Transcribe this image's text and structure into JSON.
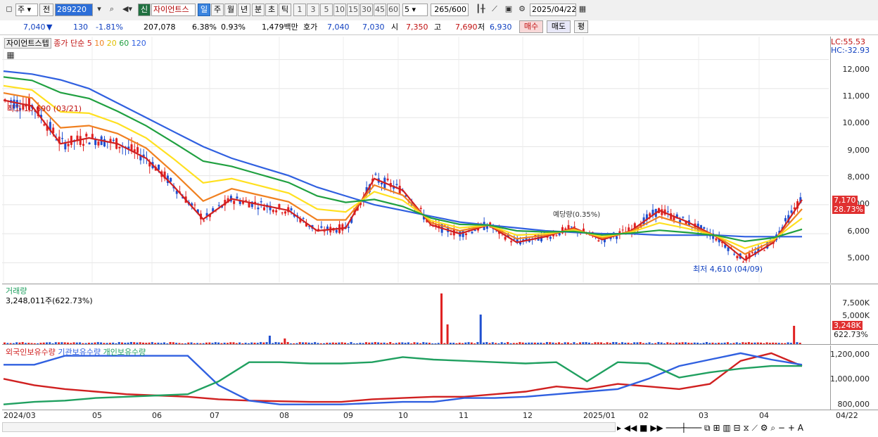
{
  "toolbar": {
    "type_select": "주",
    "prev_label": "전",
    "code_value": "289220",
    "new_badge": "신",
    "stock_name": "자이언트스",
    "period_buttons": [
      "일",
      "주",
      "월",
      "년",
      "분",
      "초",
      "틱"
    ],
    "minute_buttons": [
      "1",
      "3",
      "5",
      "10",
      "15",
      "30",
      "45",
      "60"
    ],
    "minute_value": "5",
    "count_value": "265",
    "count_total": "/600",
    "date_value": "2025/04/22"
  },
  "quote": {
    "price": "7,040",
    "arrow": "▼",
    "change": "130",
    "change_pct": "-1.81%",
    "volume": "207,078",
    "turnover": "6.38%",
    "ratio": "0.93%",
    "amount": "1,479백만",
    "ask_label": "호가",
    "ask1": "7,040",
    "ask2": "7,030",
    "open_label": "시",
    "open": "7,350",
    "high_label": "고",
    "high": "7,690",
    "low_label": "저",
    "low": "6,930",
    "buy_button": "매수",
    "sell_button": "매도",
    "eval_button": "평"
  },
  "price_panel": {
    "name": "자이언트스텝",
    "ma_label": "종가 단순",
    "ma_periods": [
      "5",
      "10",
      "20",
      "60",
      "120"
    ],
    "ma_colors": [
      "#d02020",
      "#f08020",
      "#ffe020",
      "#20a040",
      "#3060e0"
    ],
    "lc": "LC:55.53",
    "hc": "HC:-32.93",
    "high_note": "최고 10,690 (03/21)",
    "low_note": "최저 4,610 (04/09)",
    "overlay_note": "예당량(0.35%)",
    "last_price_tag": "7,170",
    "last_pct_tag": "28.73%",
    "y_ticks": [
      "12,000",
      "11,000",
      "10,000",
      "9,000",
      "8,000",
      "7,000",
      "6,000",
      "5,000"
    ]
  },
  "volume_panel": {
    "title": "거래량",
    "value": "3,248,011주(622.73%)",
    "y_ticks": [
      "7,500K",
      "5,000K"
    ],
    "last_tag": "3,248K",
    "last_pct": "622.73%"
  },
  "holding_panel": {
    "items": [
      {
        "label": "외국인보유수량",
        "color": "#d02020"
      },
      {
        "label": "기관보유수량",
        "color": "#3060e0"
      },
      {
        "label": "개인보유수량",
        "color": "#20a060"
      }
    ],
    "y_ticks": [
      "1,200,000",
      "1,000,000",
      "800,000"
    ]
  },
  "x_axis": [
    "2024/03",
    "05",
    "06",
    "07",
    "08",
    "09",
    "10",
    "11",
    "12",
    "2025/01",
    "02",
    "03",
    "04",
    "04/22"
  ],
  "chart_data": {
    "type": "line",
    "title": "자이언트스텝",
    "x_range": [
      "2024/03",
      "2025/04/22"
    ],
    "ylim": [
      4500,
      12500
    ],
    "series": [
      {
        "name": "5",
        "values": [
          10600,
          10400,
          9100,
          9300,
          9100,
          8600,
          7600,
          6500,
          7200,
          7000,
          6800,
          6100,
          6200,
          7900,
          7500,
          6300,
          6000,
          6300,
          5700,
          5900,
          6200,
          5800,
          6100,
          6800,
          6400,
          5900,
          5100,
          5700,
          7170
        ]
      },
      {
        "name": "120",
        "values": [
          11600,
          11500,
          11300,
          11000,
          10500,
          10000,
          9500,
          9000,
          8600,
          8300,
          8000,
          7600,
          7300,
          7000,
          6800,
          6600,
          6400,
          6300,
          6200,
          6100,
          6050,
          6000,
          6000,
          5950,
          5950,
          5950,
          5900,
          5900,
          5900
        ]
      }
    ],
    "volume": {
      "max_bar": "7,500K+",
      "last": "3,248,011"
    },
    "holdings": [
      {
        "name": "외국인보유수량",
        "start": 1000000,
        "end": 1100000
      },
      {
        "name": "기관보유수량",
        "start": 1100000,
        "end": 1100000
      },
      {
        "name": "개인보유수량",
        "start": 800000,
        "end": 1100000
      }
    ]
  }
}
